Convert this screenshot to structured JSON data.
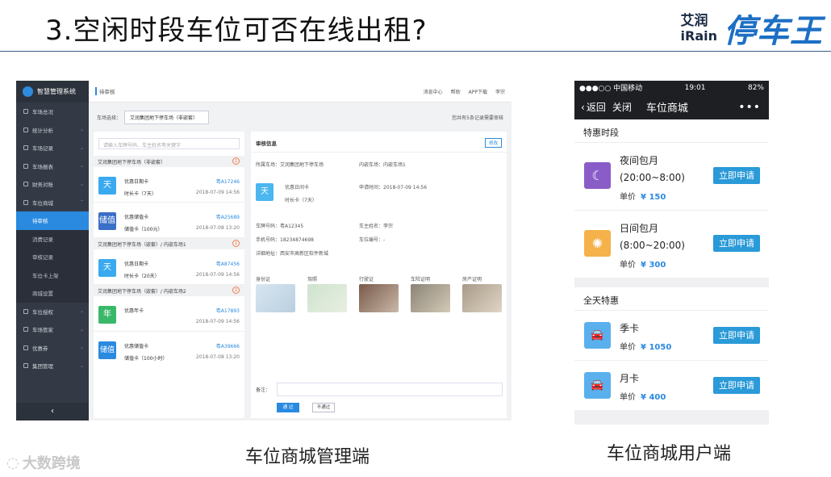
{
  "slide": {
    "title": "3.空闲时段车位可否在线出租?",
    "brand_zh": "艾润",
    "brand_en": "iRain",
    "brand_main": "停车王",
    "caption_admin": "车位商城管理端",
    "caption_user": "车位商城用户端",
    "watermark": "大数跨境"
  },
  "admin": {
    "app_name": "智慧管理系统",
    "sidebar": [
      {
        "label": "车场总况",
        "icon": "parking-icon"
      },
      {
        "label": "统计分析",
        "icon": "chart-icon"
      },
      {
        "label": "车场记录",
        "icon": "record-icon"
      },
      {
        "label": "车场报表",
        "icon": "report-icon"
      },
      {
        "label": "财务对账",
        "icon": "finance-icon"
      },
      {
        "label": "车位商城",
        "icon": "shop-icon"
      }
    ],
    "submenu": [
      "待审核",
      "消费记录",
      "审核记录",
      "车位卡上架",
      "商城设置"
    ],
    "sidebar_bottom": [
      {
        "label": "车位授权"
      },
      {
        "label": "车场管家"
      },
      {
        "label": "优惠券"
      },
      {
        "label": "集团管理"
      }
    ],
    "collapse": "‹",
    "breadcrumb": "待审核",
    "top_tools": [
      "消息中心",
      "帮助",
      "APP下载",
      "李宗"
    ],
    "filter_label": "车场选择：",
    "filter_value": "艾润集团地下停车场（非嵌套）",
    "pending_text": "您共有5条记录需要审核",
    "search_placeholder": "请输入车牌号码、车主姓名等关键字",
    "groups": [
      {
        "name": "艾润集团地下停车场（非嵌套）",
        "count": "2",
        "cards": [
          {
            "tile": "天",
            "color": "#3aaaf0",
            "name": "优惠日期卡",
            "duration": "时长卡（7天）",
            "plate": "粤A17246",
            "date": "2018-07-09 14:56"
          },
          {
            "tile": "储值",
            "color": "#3a6fc8",
            "name": "优惠储值卡",
            "duration": "储值卡（100元）",
            "plate": "粤A25689",
            "date": "2018-07-08 13:20"
          }
        ]
      },
      {
        "name": "艾润集团地下停车场（嵌套）/ 内嵌车场1",
        "count": "1",
        "cards": [
          {
            "tile": "天",
            "color": "#3aaaf0",
            "name": "优惠日期卡",
            "duration": "时长卡（20天）",
            "plate": "粤A87456",
            "date": "2018-07-09 14:56"
          }
        ]
      },
      {
        "name": "艾润集团地下停车场（嵌套）/ 内嵌车场2",
        "count": "2",
        "cards": [
          {
            "tile": "年",
            "color": "#3ab86a",
            "name": "优惠年卡",
            "duration": "",
            "plate": "粤A17893",
            "date": "2018-07-09 14:56"
          },
          {
            "tile": "储值",
            "color": "#2a8ae0",
            "name": "优惠储值卡",
            "duration": "储值卡（100小时）",
            "plate": "粤A39666",
            "date": "2018-07-08 13:20"
          }
        ]
      }
    ],
    "detail": {
      "header": "审核信息",
      "edit": "修改",
      "lot": "所属车场：艾润集团地下停车场",
      "inner_lot": "内嵌车场：内嵌车场1",
      "tile": "天",
      "card_name": "优惠日间卡",
      "card_dur": "时长卡（7天）",
      "apply_time": "申请时间：2018-07-09  14:56",
      "plate": "车牌号码：粤A12345",
      "owner": "车主姓名：李宗",
      "phone": "手机号码：18234874698",
      "slot": "车位编号：-",
      "address": "详细地址：西安市高新区软件新城",
      "docs": [
        "身份证",
        "驾照",
        "行驶证",
        "车险证明",
        "房产证明"
      ],
      "remark_label": "备注：",
      "pass": "通 过",
      "reject": "不通过"
    }
  },
  "phone": {
    "status_left": "●●●○○ 中国移动",
    "status_time": "19:01",
    "status_right": "82%",
    "back": "返回",
    "close": "关闭",
    "title": "车位商城",
    "more": "•••",
    "section1": "特惠时段",
    "section2": "全天特惠",
    "price_label": "单价",
    "apply_label": "立即申请",
    "items_special": [
      {
        "name": "夜间包月",
        "time": "(20:00~8:00)",
        "price": "¥ 150",
        "icon": "moon-icon",
        "color": "#8a5cc8"
      },
      {
        "name": "日间包月",
        "time": "(8:00~20:00)",
        "price": "¥ 300",
        "icon": "sun-icon",
        "color": "#f5b14a"
      }
    ],
    "items_allday": [
      {
        "name": "季卡",
        "price": "¥ 1050",
        "icon": "car-icon",
        "color": "#5ab0ec"
      },
      {
        "name": "月卡",
        "price": "¥ 400",
        "icon": "car-icon",
        "color": "#5ab0ec"
      }
    ]
  }
}
